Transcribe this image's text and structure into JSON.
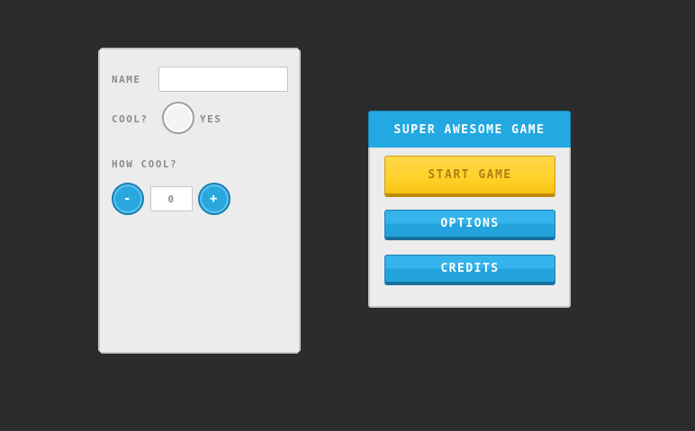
{
  "form": {
    "name_label": "NAME",
    "name_value": "",
    "cool_label": "COOL?",
    "cool_checked": false,
    "yes_label": "YES",
    "how_cool_label": "HOW COOL?",
    "minus_label": "-",
    "plus_label": "+",
    "stepper_value": "0"
  },
  "menu": {
    "title": "SUPER AWESOME GAME",
    "start_label": "START GAME",
    "options_label": "OPTIONS",
    "credits_label": "CREDITS"
  },
  "colors": {
    "background": "#2c2c2c",
    "panel": "#ececec",
    "accent_blue": "#23a9e1",
    "accent_yellow": "#ffd12a"
  }
}
